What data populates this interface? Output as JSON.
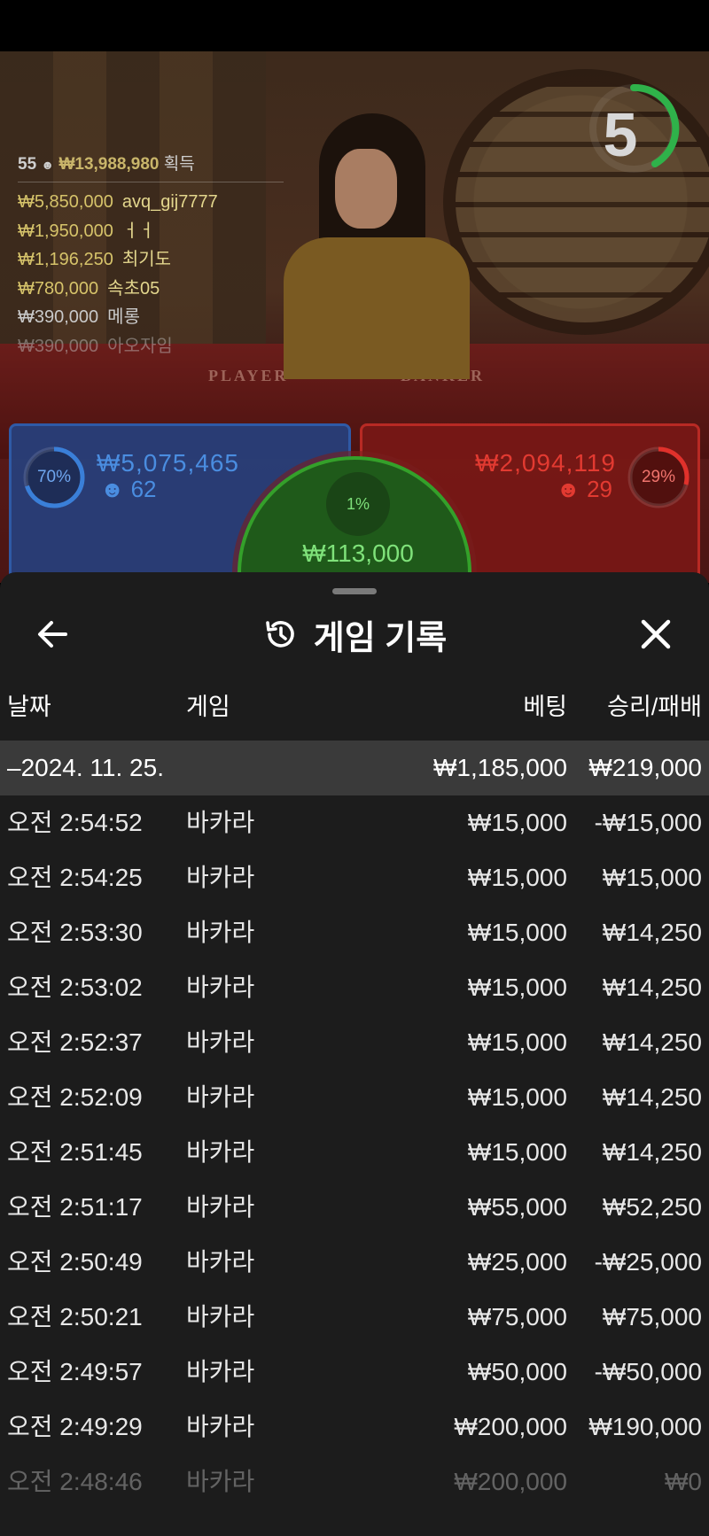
{
  "stream": {
    "timer": "5",
    "table_labels": {
      "player": "PLAYER",
      "banker": "BANKER"
    },
    "leaderboard": {
      "winner_count": "55",
      "total": "₩13,988,980",
      "total_suffix": "획득",
      "entries": [
        {
          "amount": "₩5,850,000",
          "name": "avq_gij7777"
        },
        {
          "amount": "₩1,950,000",
          "name": "ㅓㅓ"
        },
        {
          "amount": "₩1,196,250",
          "name": "최기도"
        },
        {
          "amount": "₩780,000",
          "name": "속초05"
        },
        {
          "amount": "₩390,000",
          "name": "메롱"
        },
        {
          "amount": "₩390,000",
          "name": "아오자임"
        }
      ]
    },
    "player_bet": {
      "percent": "70%",
      "percent_value": 0.7,
      "amount": "₩5,075,465",
      "players": "62",
      "color": "#3a7fd8"
    },
    "banker_bet": {
      "percent": "29%",
      "percent_value": 0.29,
      "amount": "₩2,094,119",
      "players": "29",
      "color": "#e0312b"
    },
    "tie_bet": {
      "percent": "1%",
      "amount": "₩113,000"
    }
  },
  "sheet": {
    "title": "게임 기록",
    "columns": {
      "date": "날짜",
      "game": "게임",
      "bet": "베팅",
      "result": "승리/패배"
    },
    "summary": {
      "date": "–2024. 11. 25.",
      "bet": "₩1,185,000",
      "result": "₩219,000"
    },
    "rows": [
      {
        "time": "오전 2:54:52",
        "game": "바카라",
        "bet": "₩15,000",
        "result": "-₩15,000"
      },
      {
        "time": "오전 2:54:25",
        "game": "바카라",
        "bet": "₩15,000",
        "result": "₩15,000"
      },
      {
        "time": "오전 2:53:30",
        "game": "바카라",
        "bet": "₩15,000",
        "result": "₩14,250"
      },
      {
        "time": "오전 2:53:02",
        "game": "바카라",
        "bet": "₩15,000",
        "result": "₩14,250"
      },
      {
        "time": "오전 2:52:37",
        "game": "바카라",
        "bet": "₩15,000",
        "result": "₩14,250"
      },
      {
        "time": "오전 2:52:09",
        "game": "바카라",
        "bet": "₩15,000",
        "result": "₩14,250"
      },
      {
        "time": "오전 2:51:45",
        "game": "바카라",
        "bet": "₩15,000",
        "result": "₩14,250"
      },
      {
        "time": "오전 2:51:17",
        "game": "바카라",
        "bet": "₩55,000",
        "result": "₩52,250"
      },
      {
        "time": "오전 2:50:49",
        "game": "바카라",
        "bet": "₩25,000",
        "result": "-₩25,000"
      },
      {
        "time": "오전 2:50:21",
        "game": "바카라",
        "bet": "₩75,000",
        "result": "₩75,000"
      },
      {
        "time": "오전 2:49:57",
        "game": "바카라",
        "bet": "₩50,000",
        "result": "-₩50,000"
      },
      {
        "time": "오전 2:49:29",
        "game": "바카라",
        "bet": "₩200,000",
        "result": "₩190,000"
      },
      {
        "time": "오전 2:48:46",
        "game": "바카라",
        "bet": "₩200,000",
        "result": "₩0"
      }
    ]
  }
}
